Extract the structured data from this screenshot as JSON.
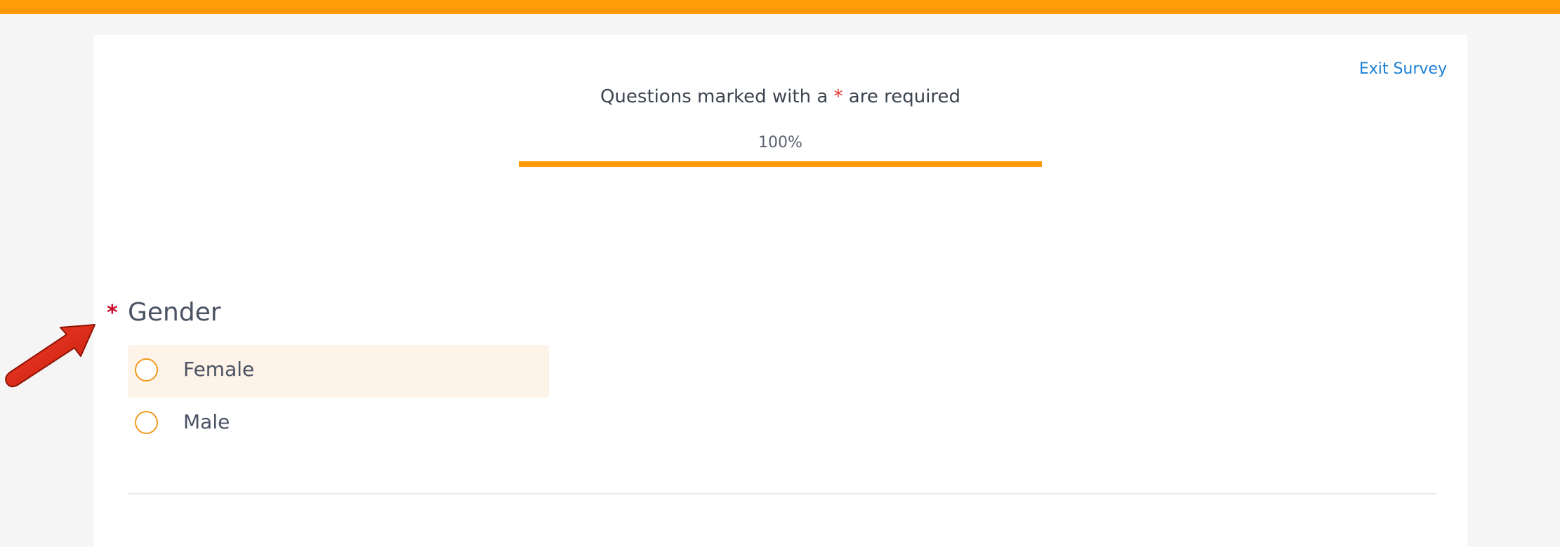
{
  "header": {
    "exit_label": "Exit Survey"
  },
  "notice": {
    "prefix": "Questions marked with a ",
    "star": "*",
    "suffix": " are required"
  },
  "progress": {
    "label": "100%",
    "value": 1.0
  },
  "question": {
    "required_marker": "*",
    "title": "Gender",
    "options": [
      {
        "label": "Female"
      },
      {
        "label": "Male"
      }
    ]
  },
  "colors": {
    "accent": "#ff9a08",
    "link": "#1a7fd4",
    "required": "#c8102e",
    "highlight": "#fdf3e8"
  }
}
